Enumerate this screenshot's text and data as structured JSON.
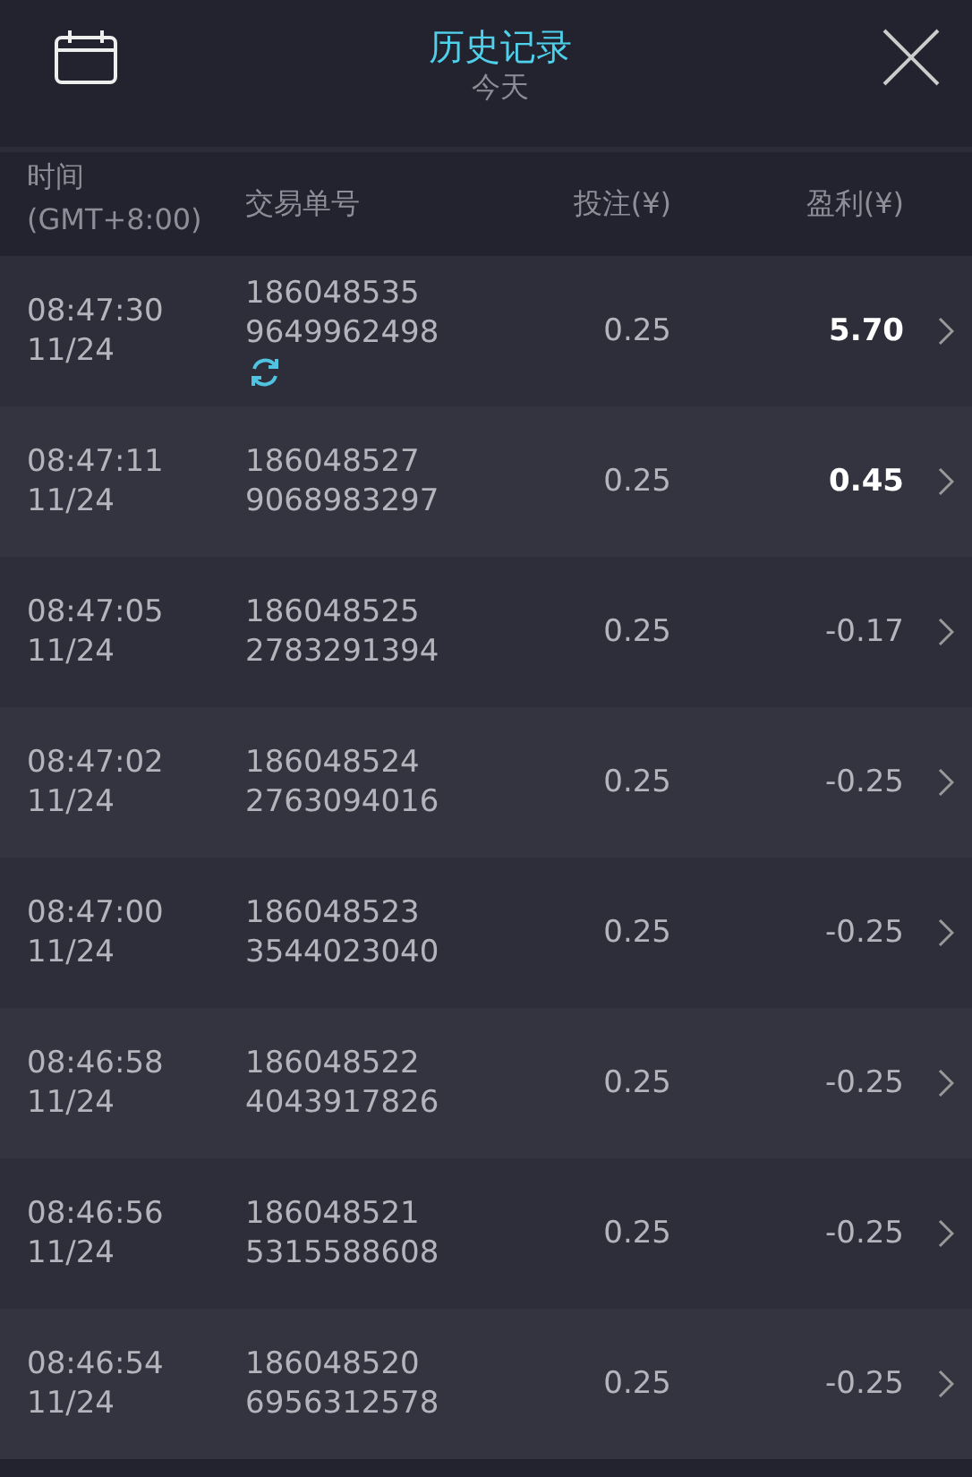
{
  "header": {
    "title": "历史记录",
    "subtitle": "今天"
  },
  "columns": [
    "时间\n(GMT+8:00)",
    "交易单号",
    "投注(¥)",
    "盈利(¥)"
  ],
  "rows": [
    {
      "time": "08:47:30",
      "date": "11/24",
      "order_line_1": "186048535",
      "order_line_2": "9649962498",
      "stake": "0.25",
      "profit": "5.70",
      "won": true,
      "syncing": true
    },
    {
      "time": "08:47:11",
      "date": "11/24",
      "order_line_1": "186048527",
      "order_line_2": "9068983297",
      "stake": "0.25",
      "profit": "0.45",
      "won": true,
      "syncing": false
    },
    {
      "time": "08:47:05",
      "date": "11/24",
      "order_line_1": "186048525",
      "order_line_2": "2783291394",
      "stake": "0.25",
      "profit": "-0.17",
      "won": false,
      "syncing": false
    },
    {
      "time": "08:47:02",
      "date": "11/24",
      "order_line_1": "186048524",
      "order_line_2": "2763094016",
      "stake": "0.25",
      "profit": "-0.25",
      "won": false,
      "syncing": false
    },
    {
      "time": "08:47:00",
      "date": "11/24",
      "order_line_1": "186048523",
      "order_line_2": "3544023040",
      "stake": "0.25",
      "profit": "-0.25",
      "won": false,
      "syncing": false
    },
    {
      "time": "08:46:58",
      "date": "11/24",
      "order_line_1": "186048522",
      "order_line_2": "4043917826",
      "stake": "0.25",
      "profit": "-0.25",
      "won": false,
      "syncing": false
    },
    {
      "time": "08:46:56",
      "date": "11/24",
      "order_line_1": "186048521",
      "order_line_2": "5315588608",
      "stake": "0.25",
      "profit": "-0.25",
      "won": false,
      "syncing": false
    },
    {
      "time": "08:46:54",
      "date": "11/24",
      "order_line_1": "186048520",
      "order_line_2": "6956312578",
      "stake": "0.25",
      "profit": "-0.25",
      "won": false,
      "syncing": false
    }
  ]
}
